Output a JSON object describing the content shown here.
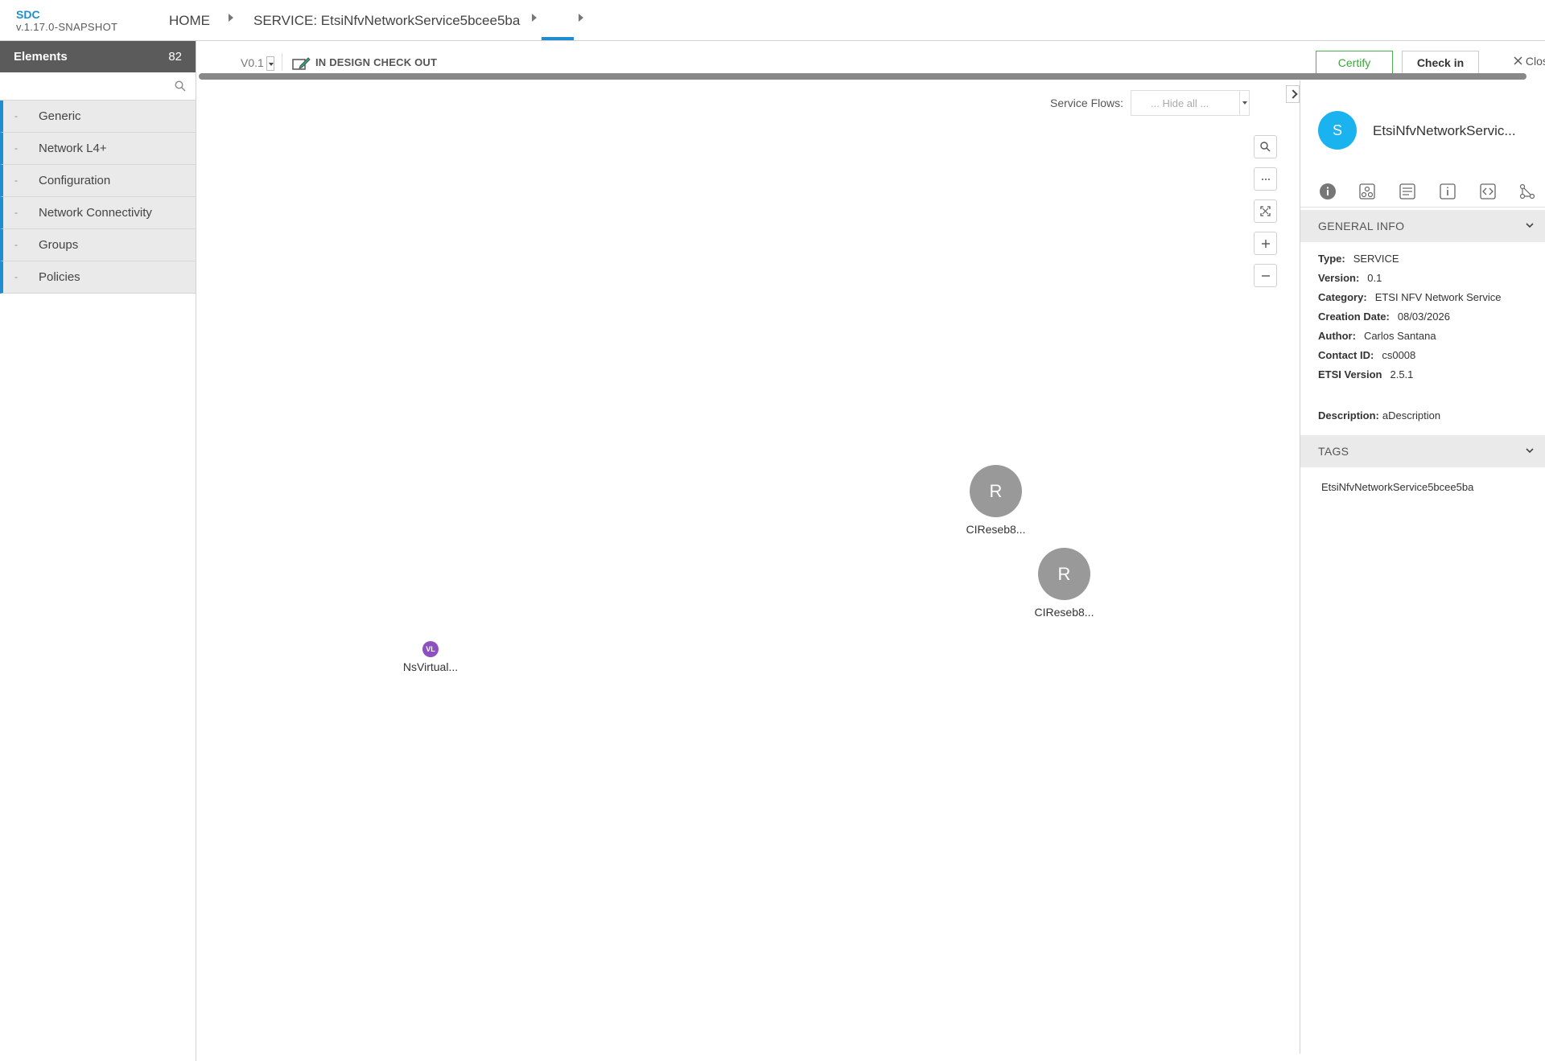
{
  "header": {
    "app_name": "SDC",
    "app_version": "v.1.17.0-SNAPSHOT",
    "breadcrumbs": [
      "HOME",
      "SERVICE: EtsiNfvNetworkService5bcee5ba",
      ""
    ]
  },
  "palette": {
    "title": "Elements",
    "count": "82",
    "search_placeholder": "",
    "dash": "-",
    "categories": [
      {
        "label": "Generic"
      },
      {
        "label": "Network L4+"
      },
      {
        "label": "Configuration"
      },
      {
        "label": "Network Connectivity"
      },
      {
        "label": "Groups"
      },
      {
        "label": "Policies"
      }
    ]
  },
  "toolbar": {
    "version": "V0.1",
    "status": "IN DESIGN CHECK OUT",
    "certify_label": "Certify",
    "checkin_label": "Check in",
    "close_label": "Close"
  },
  "canvas": {
    "service_flows_label": "Service Flows:",
    "service_flows_selected": "... Hide all ...",
    "zoom_buttons": [
      "search-icon",
      "more-icon",
      "fit-icon",
      "zoom-in-icon",
      "zoom-out-icon"
    ],
    "nodes": [
      {
        "icon_text": "R",
        "name": "CIReseb8..."
      },
      {
        "icon_text": "R",
        "name": "CIReseb8..."
      },
      {
        "icon_text": "VL",
        "name": "NsVirtual..."
      }
    ]
  },
  "right_panel": {
    "avatar_letter": "S",
    "name": "EtsiNfvNetworkServic...",
    "tabs": [
      "info-icon",
      "composition-icon",
      "properties-icon",
      "details-icon",
      "api-icon",
      "deployment-icon"
    ],
    "general_info": {
      "title": "GENERAL INFO",
      "rows": [
        {
          "key": "Type:",
          "value": "SERVICE"
        },
        {
          "key": "Version:",
          "value": "0.1"
        },
        {
          "key": "Category:",
          "value": "ETSI NFV Network Service"
        },
        {
          "key": "Creation Date:",
          "value": "08/03/2026"
        },
        {
          "key": "Author:",
          "value": "Carlos Santana"
        },
        {
          "key": "Contact ID:",
          "value": "cs0008"
        },
        {
          "key": "ETSI Version",
          "value": "2.5.1"
        }
      ],
      "description_key": "Description:",
      "description_value": "aDescription"
    },
    "tags": {
      "title": "TAGS",
      "items": [
        "EtsiNfvNetworkService5bcee5ba"
      ]
    }
  },
  "colors": {
    "accent": "#1e8ed1",
    "palette_header": "#5b5b5b",
    "node_gray": "#999999",
    "vl_purple": "#8e4fbf",
    "avatar_blue": "#1ab3f0",
    "certify_green": "#3aa63a"
  }
}
